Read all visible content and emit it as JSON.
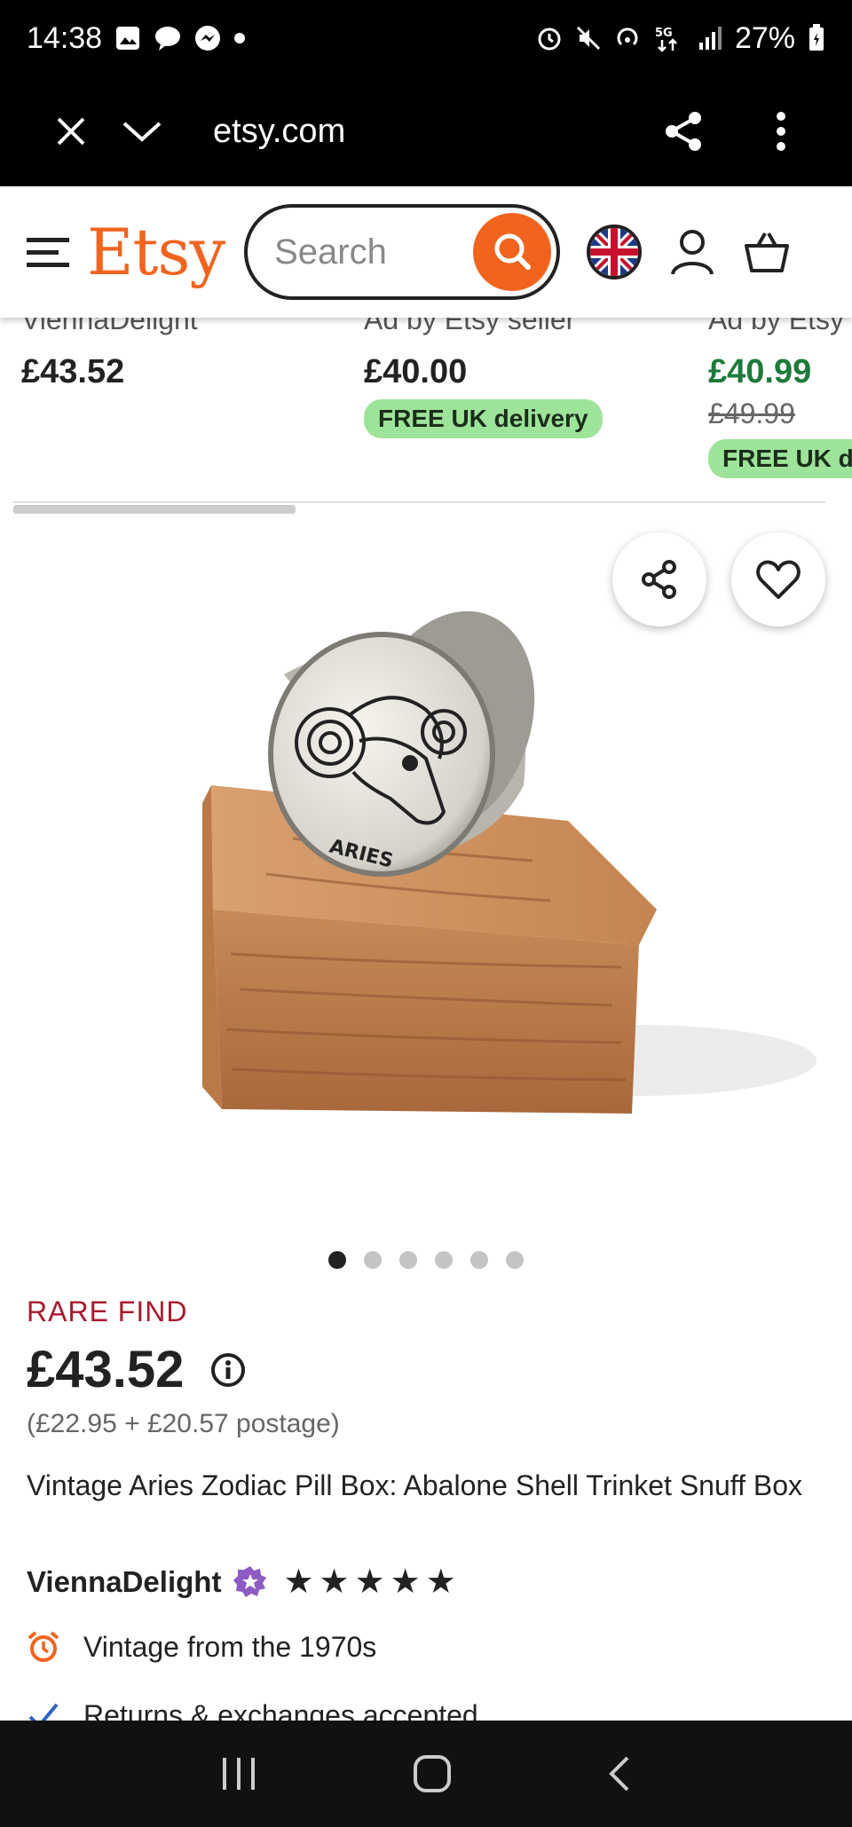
{
  "status_bar": {
    "time": "14:38",
    "battery": "27%"
  },
  "browser": {
    "url": "etsy.com"
  },
  "header": {
    "logo": "Etsy",
    "search_placeholder": "Search"
  },
  "recommendations": [
    {
      "seller": "ViennaDelight",
      "price": "£43.52"
    },
    {
      "seller": "Ad by Etsy seller",
      "price": "£40.00",
      "badge": "FREE UK delivery"
    },
    {
      "seller": "Ad by Etsy seller",
      "price": "£40.99",
      "old_price": "£49.99",
      "badge": "FREE UK delivery"
    }
  ],
  "gallery": {
    "image_count": 6,
    "active_index": 0,
    "image_label": "ARIES"
  },
  "product": {
    "tag": "RARE FIND",
    "price": "£43.52",
    "breakdown": "(£22.95 + £20.57 postage)",
    "title": "Vintage Aries Zodiac Pill Box: Abalone Shell Trinket Snuff Box",
    "seller": "ViennaDelight",
    "rating": 5,
    "features": [
      {
        "icon": "alarm-clock-icon",
        "text": "Vintage from the 1970s"
      },
      {
        "icon": "checkmark-icon",
        "text": "Returns & exchanges accepted"
      }
    ]
  },
  "colors": {
    "brand": "#F1641E",
    "rare": "#a61a2e",
    "sale": "#1e7a3a",
    "badge": "#9ee39a"
  }
}
